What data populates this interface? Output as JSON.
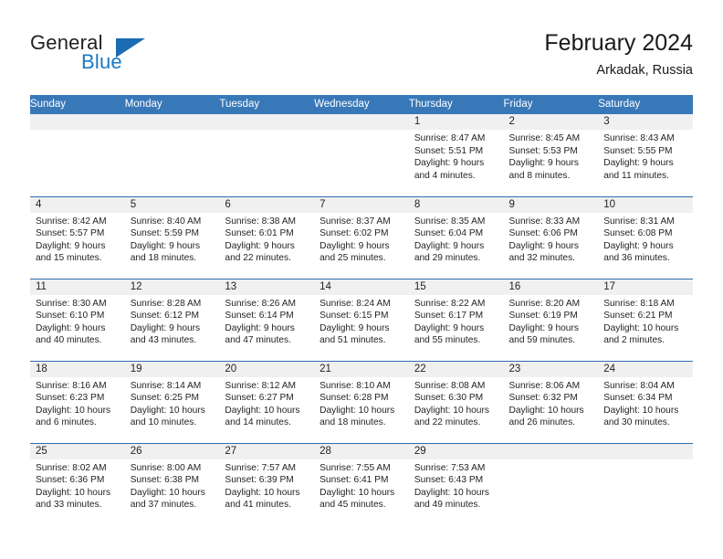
{
  "brand": {
    "name_part1": "General",
    "name_part2": "Blue",
    "logo_icon": "triangle-flag-icon"
  },
  "header": {
    "title": "February 2024",
    "location": "Arkadak, Russia"
  },
  "weekday_headers": [
    "Sunday",
    "Monday",
    "Tuesday",
    "Wednesday",
    "Thursday",
    "Friday",
    "Saturday"
  ],
  "colors": {
    "header_blue": "#3878b8",
    "row_rule_blue": "#2f6eaf",
    "daynum_strip": "#f0f0f0",
    "brand_blue": "#1b79c4",
    "text": "#231f20"
  },
  "weeks": [
    [
      {
        "day": "",
        "lines": []
      },
      {
        "day": "",
        "lines": []
      },
      {
        "day": "",
        "lines": []
      },
      {
        "day": "",
        "lines": []
      },
      {
        "day": "1",
        "lines": [
          "Sunrise: 8:47 AM",
          "Sunset: 5:51 PM",
          "Daylight: 9 hours",
          "and 4 minutes."
        ]
      },
      {
        "day": "2",
        "lines": [
          "Sunrise: 8:45 AM",
          "Sunset: 5:53 PM",
          "Daylight: 9 hours",
          "and 8 minutes."
        ]
      },
      {
        "day": "3",
        "lines": [
          "Sunrise: 8:43 AM",
          "Sunset: 5:55 PM",
          "Daylight: 9 hours",
          "and 11 minutes."
        ]
      }
    ],
    [
      {
        "day": "4",
        "lines": [
          "Sunrise: 8:42 AM",
          "Sunset: 5:57 PM",
          "Daylight: 9 hours",
          "and 15 minutes."
        ]
      },
      {
        "day": "5",
        "lines": [
          "Sunrise: 8:40 AM",
          "Sunset: 5:59 PM",
          "Daylight: 9 hours",
          "and 18 minutes."
        ]
      },
      {
        "day": "6",
        "lines": [
          "Sunrise: 8:38 AM",
          "Sunset: 6:01 PM",
          "Daylight: 9 hours",
          "and 22 minutes."
        ]
      },
      {
        "day": "7",
        "lines": [
          "Sunrise: 8:37 AM",
          "Sunset: 6:02 PM",
          "Daylight: 9 hours",
          "and 25 minutes."
        ]
      },
      {
        "day": "8",
        "lines": [
          "Sunrise: 8:35 AM",
          "Sunset: 6:04 PM",
          "Daylight: 9 hours",
          "and 29 minutes."
        ]
      },
      {
        "day": "9",
        "lines": [
          "Sunrise: 8:33 AM",
          "Sunset: 6:06 PM",
          "Daylight: 9 hours",
          "and 32 minutes."
        ]
      },
      {
        "day": "10",
        "lines": [
          "Sunrise: 8:31 AM",
          "Sunset: 6:08 PM",
          "Daylight: 9 hours",
          "and 36 minutes."
        ]
      }
    ],
    [
      {
        "day": "11",
        "lines": [
          "Sunrise: 8:30 AM",
          "Sunset: 6:10 PM",
          "Daylight: 9 hours",
          "and 40 minutes."
        ]
      },
      {
        "day": "12",
        "lines": [
          "Sunrise: 8:28 AM",
          "Sunset: 6:12 PM",
          "Daylight: 9 hours",
          "and 43 minutes."
        ]
      },
      {
        "day": "13",
        "lines": [
          "Sunrise: 8:26 AM",
          "Sunset: 6:14 PM",
          "Daylight: 9 hours",
          "and 47 minutes."
        ]
      },
      {
        "day": "14",
        "lines": [
          "Sunrise: 8:24 AM",
          "Sunset: 6:15 PM",
          "Daylight: 9 hours",
          "and 51 minutes."
        ]
      },
      {
        "day": "15",
        "lines": [
          "Sunrise: 8:22 AM",
          "Sunset: 6:17 PM",
          "Daylight: 9 hours",
          "and 55 minutes."
        ]
      },
      {
        "day": "16",
        "lines": [
          "Sunrise: 8:20 AM",
          "Sunset: 6:19 PM",
          "Daylight: 9 hours",
          "and 59 minutes."
        ]
      },
      {
        "day": "17",
        "lines": [
          "Sunrise: 8:18 AM",
          "Sunset: 6:21 PM",
          "Daylight: 10 hours",
          "and 2 minutes."
        ]
      }
    ],
    [
      {
        "day": "18",
        "lines": [
          "Sunrise: 8:16 AM",
          "Sunset: 6:23 PM",
          "Daylight: 10 hours",
          "and 6 minutes."
        ]
      },
      {
        "day": "19",
        "lines": [
          "Sunrise: 8:14 AM",
          "Sunset: 6:25 PM",
          "Daylight: 10 hours",
          "and 10 minutes."
        ]
      },
      {
        "day": "20",
        "lines": [
          "Sunrise: 8:12 AM",
          "Sunset: 6:27 PM",
          "Daylight: 10 hours",
          "and 14 minutes."
        ]
      },
      {
        "day": "21",
        "lines": [
          "Sunrise: 8:10 AM",
          "Sunset: 6:28 PM",
          "Daylight: 10 hours",
          "and 18 minutes."
        ]
      },
      {
        "day": "22",
        "lines": [
          "Sunrise: 8:08 AM",
          "Sunset: 6:30 PM",
          "Daylight: 10 hours",
          "and 22 minutes."
        ]
      },
      {
        "day": "23",
        "lines": [
          "Sunrise: 8:06 AM",
          "Sunset: 6:32 PM",
          "Daylight: 10 hours",
          "and 26 minutes."
        ]
      },
      {
        "day": "24",
        "lines": [
          "Sunrise: 8:04 AM",
          "Sunset: 6:34 PM",
          "Daylight: 10 hours",
          "and 30 minutes."
        ]
      }
    ],
    [
      {
        "day": "25",
        "lines": [
          "Sunrise: 8:02 AM",
          "Sunset: 6:36 PM",
          "Daylight: 10 hours",
          "and 33 minutes."
        ]
      },
      {
        "day": "26",
        "lines": [
          "Sunrise: 8:00 AM",
          "Sunset: 6:38 PM",
          "Daylight: 10 hours",
          "and 37 minutes."
        ]
      },
      {
        "day": "27",
        "lines": [
          "Sunrise: 7:57 AM",
          "Sunset: 6:39 PM",
          "Daylight: 10 hours",
          "and 41 minutes."
        ]
      },
      {
        "day": "28",
        "lines": [
          "Sunrise: 7:55 AM",
          "Sunset: 6:41 PM",
          "Daylight: 10 hours",
          "and 45 minutes."
        ]
      },
      {
        "day": "29",
        "lines": [
          "Sunrise: 7:53 AM",
          "Sunset: 6:43 PM",
          "Daylight: 10 hours",
          "and 49 minutes."
        ]
      },
      {
        "day": "",
        "lines": []
      },
      {
        "day": "",
        "lines": []
      }
    ]
  ]
}
